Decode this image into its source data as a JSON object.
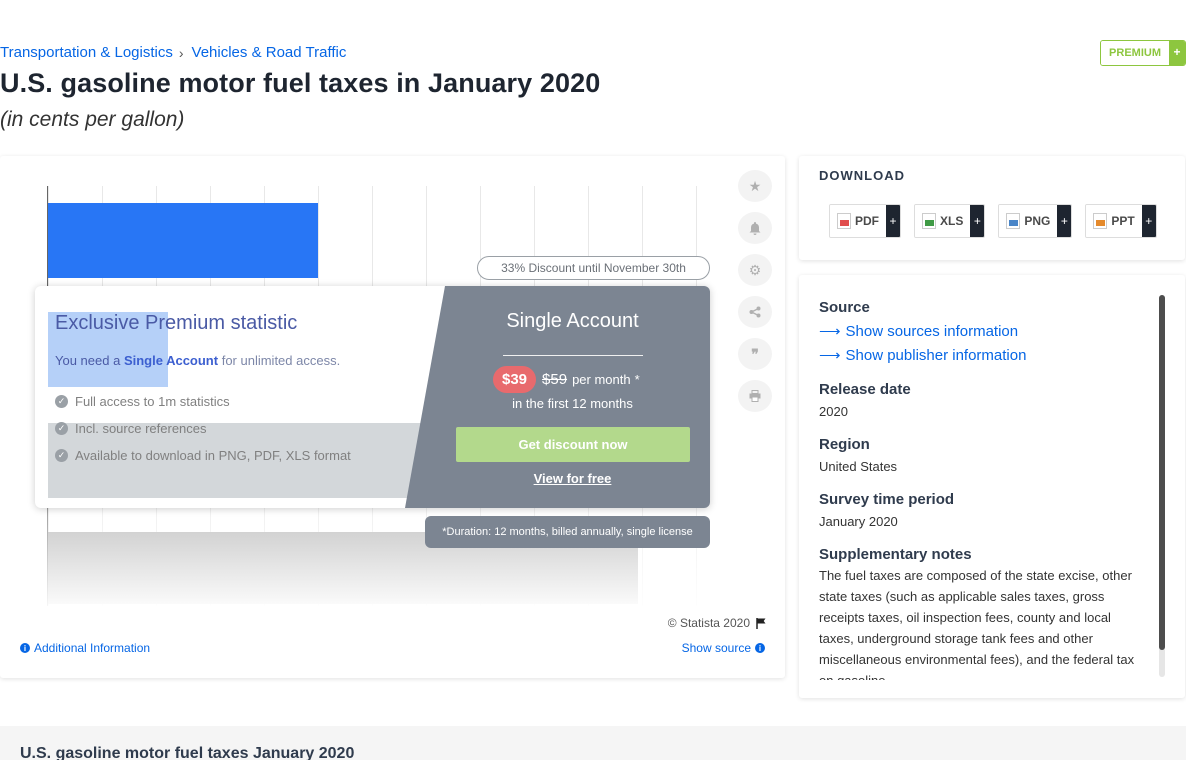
{
  "breadcrumb": [
    "Transportation & Logistics",
    "Vehicles & Road Traffic"
  ],
  "premium_badge": "PREMIUM",
  "title": "U.S. gasoline motor fuel taxes in January 2020",
  "subtitle": "(in cents per gallon)",
  "chart_data": {
    "type": "bar",
    "orientation": "horizontal",
    "title": "",
    "xlabel": "",
    "ylabel": "",
    "categories": [
      "",
      ""
    ],
    "values": [],
    "note": ""
  },
  "promo": {
    "discount_pill": "33% Discount until November 30th",
    "headline": "Exclusive Premium statistic",
    "need_prefix": "You need a",
    "need_bold": "Single Account",
    "need_suffix": "for unlimited access.",
    "features": [
      "Full access to 1m statistics",
      "Incl. source references",
      "Available to download in PNG, PDF, XLS format"
    ],
    "account_title": "Single Account",
    "price_new": "$39",
    "price_old": "$59",
    "per_month": "per month",
    "asterisk": "*",
    "first_year": "in the first 12 months",
    "cta": "Get discount now",
    "free_link": "View for free",
    "duration": "*Duration: 12 months, billed annually, single license"
  },
  "side_icons": [
    "star-icon",
    "bell-icon",
    "gear-icon",
    "share-icon",
    "quote-icon",
    "print-icon"
  ],
  "footer": {
    "copyright": "© Statista 2020",
    "additional_info": "Additional Information",
    "show_source": "Show source"
  },
  "download": {
    "title": "DOWNLOAD",
    "buttons": [
      {
        "label": "PDF",
        "color": "#e04c4c"
      },
      {
        "label": "XLS",
        "color": "#3f9a45"
      },
      {
        "label": "PNG",
        "color": "#4a86c8"
      },
      {
        "label": "PPT",
        "color": "#e58a2c"
      }
    ]
  },
  "info": {
    "source_label": "Source",
    "show_sources": "Show sources information",
    "show_publisher": "Show publisher information",
    "release_label": "Release date",
    "release_value": "2020",
    "region_label": "Region",
    "region_value": "United States",
    "survey_label": "Survey time period",
    "survey_value": "January 2020",
    "notes_label": "Supplementary notes",
    "notes_value": "The fuel taxes are composed of the state excise, other state taxes (such as applicable sales taxes, gross receipts taxes, oil inspection fees, county and local taxes, underground storage tank fees and other miscellaneous environmental fees), and the federal tax on gasoline."
  },
  "bottom_title": "U.S. gasoline motor fuel taxes January 2020",
  "colors": {
    "accent": "#0666e5",
    "bar": "#2876f5",
    "premium": "#8dc63f",
    "promo_panel": "#7c8592",
    "price_badge": "#e86a6d"
  }
}
